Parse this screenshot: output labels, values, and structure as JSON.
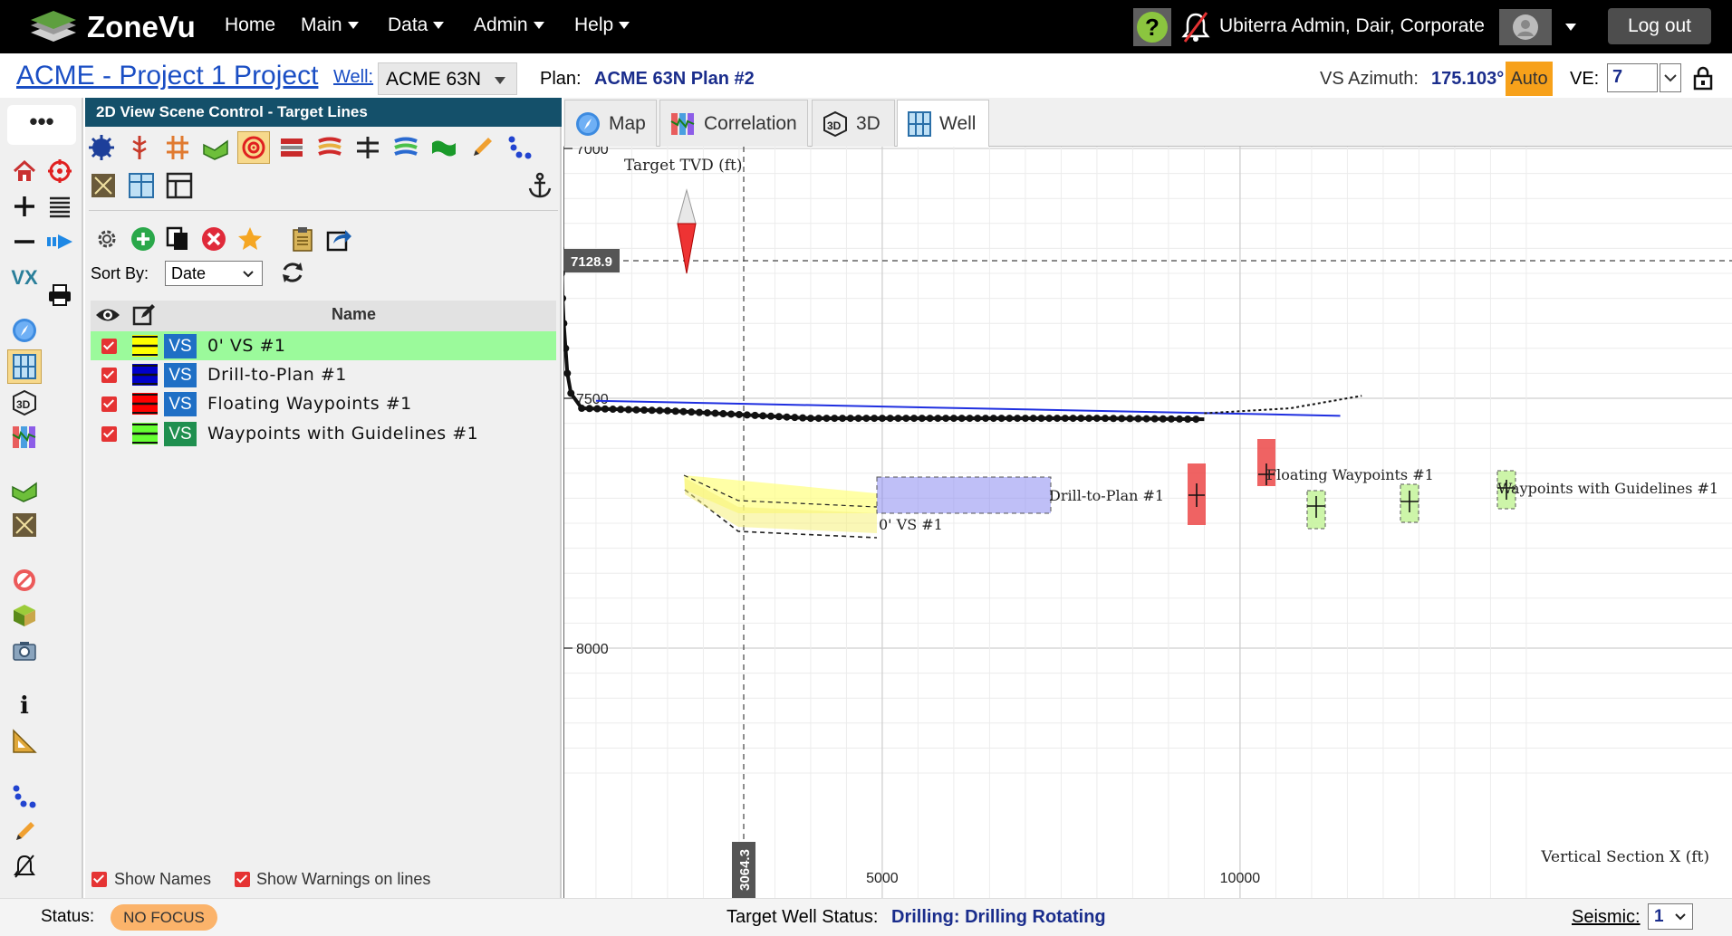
{
  "app": {
    "name": "ZoneVu",
    "nav": [
      "Home",
      "Main",
      "Data",
      "Admin",
      "Help"
    ],
    "user": "Ubiterra Admin, Dair, Corporate",
    "logout": "Log out"
  },
  "project": {
    "title": "ACME - Project 1 Project",
    "well_label": "Well:",
    "well_value": "ACME 63N",
    "plan_label": "Plan:",
    "plan_value": "ACME 63N Plan #2",
    "vs_azimuth_label": "VS Azimuth:",
    "vs_azimuth_value": "175.103°",
    "auto_label": "Auto",
    "ve_label": "VE:",
    "ve_value": "7"
  },
  "left_toolbar": {
    "more": "•••",
    "vx": "VX"
  },
  "panel": {
    "header": "2D View Scene Control - Target Lines",
    "sort_by_label": "Sort By:",
    "sort_by_value": "Date",
    "name_column": "Name",
    "vs_badge": "VS",
    "rows": [
      {
        "name": "0' VS #1",
        "color": "#ffff00",
        "badge": "#1f6fc5",
        "selected": true
      },
      {
        "name": "Drill-to-Plan #1",
        "color": "#0000c8",
        "badge": "#1f6fc5",
        "selected": false
      },
      {
        "name": "Floating Waypoints #1",
        "color": "#ff0000",
        "badge": "#1f6fc5",
        "selected": false
      },
      {
        "name": "Waypoints with Guidelines #1",
        "color": "#66ff33",
        "badge": "#1f8f4f",
        "selected": false
      }
    ],
    "show_names": "Show Names",
    "show_warnings": "Show Warnings on lines"
  },
  "tabs": [
    "Map",
    "Correlation",
    "3D",
    "Well"
  ],
  "active_tab": "Well",
  "status": {
    "label": "Status:",
    "badge": "NO FOCUS",
    "target_well_label": "Target Well Status:",
    "target_well_value": "Drilling: Drilling Rotating",
    "seismic_label": "Seismic:",
    "seismic_value": "1"
  },
  "chart_data": {
    "type": "line",
    "ylabel": "Target TVD (ft)",
    "xlabel": "Vertical Section X (ft)",
    "y_ticks": [
      7000,
      7500,
      8000
    ],
    "x_ticks": [
      5000,
      10000
    ],
    "cursor_y": "7128.9",
    "cursor_x": "3064.3",
    "annotations": [
      "0' VS #1",
      "Drill-to-Plan #1",
      "Floating Waypoints #1",
      "Waypoints with Guidelines #1"
    ],
    "grid": true,
    "plan_line": [
      [
        1000,
        7505
      ],
      [
        11400,
        7535
      ]
    ],
    "well_path": [
      [
        400,
        6950
      ],
      [
        450,
        7050
      ],
      [
        500,
        7200
      ],
      [
        550,
        7350
      ],
      [
        600,
        7450
      ],
      [
        650,
        7490
      ],
      [
        800,
        7520
      ],
      [
        2000,
        7525
      ],
      [
        4000,
        7540
      ],
      [
        6000,
        7540
      ],
      [
        8000,
        7540
      ],
      [
        9500,
        7542
      ]
    ],
    "waypoints_guidelines": [
      [
        9500,
        7530
      ],
      [
        10700,
        7520
      ],
      [
        11700,
        7495
      ]
    ]
  }
}
